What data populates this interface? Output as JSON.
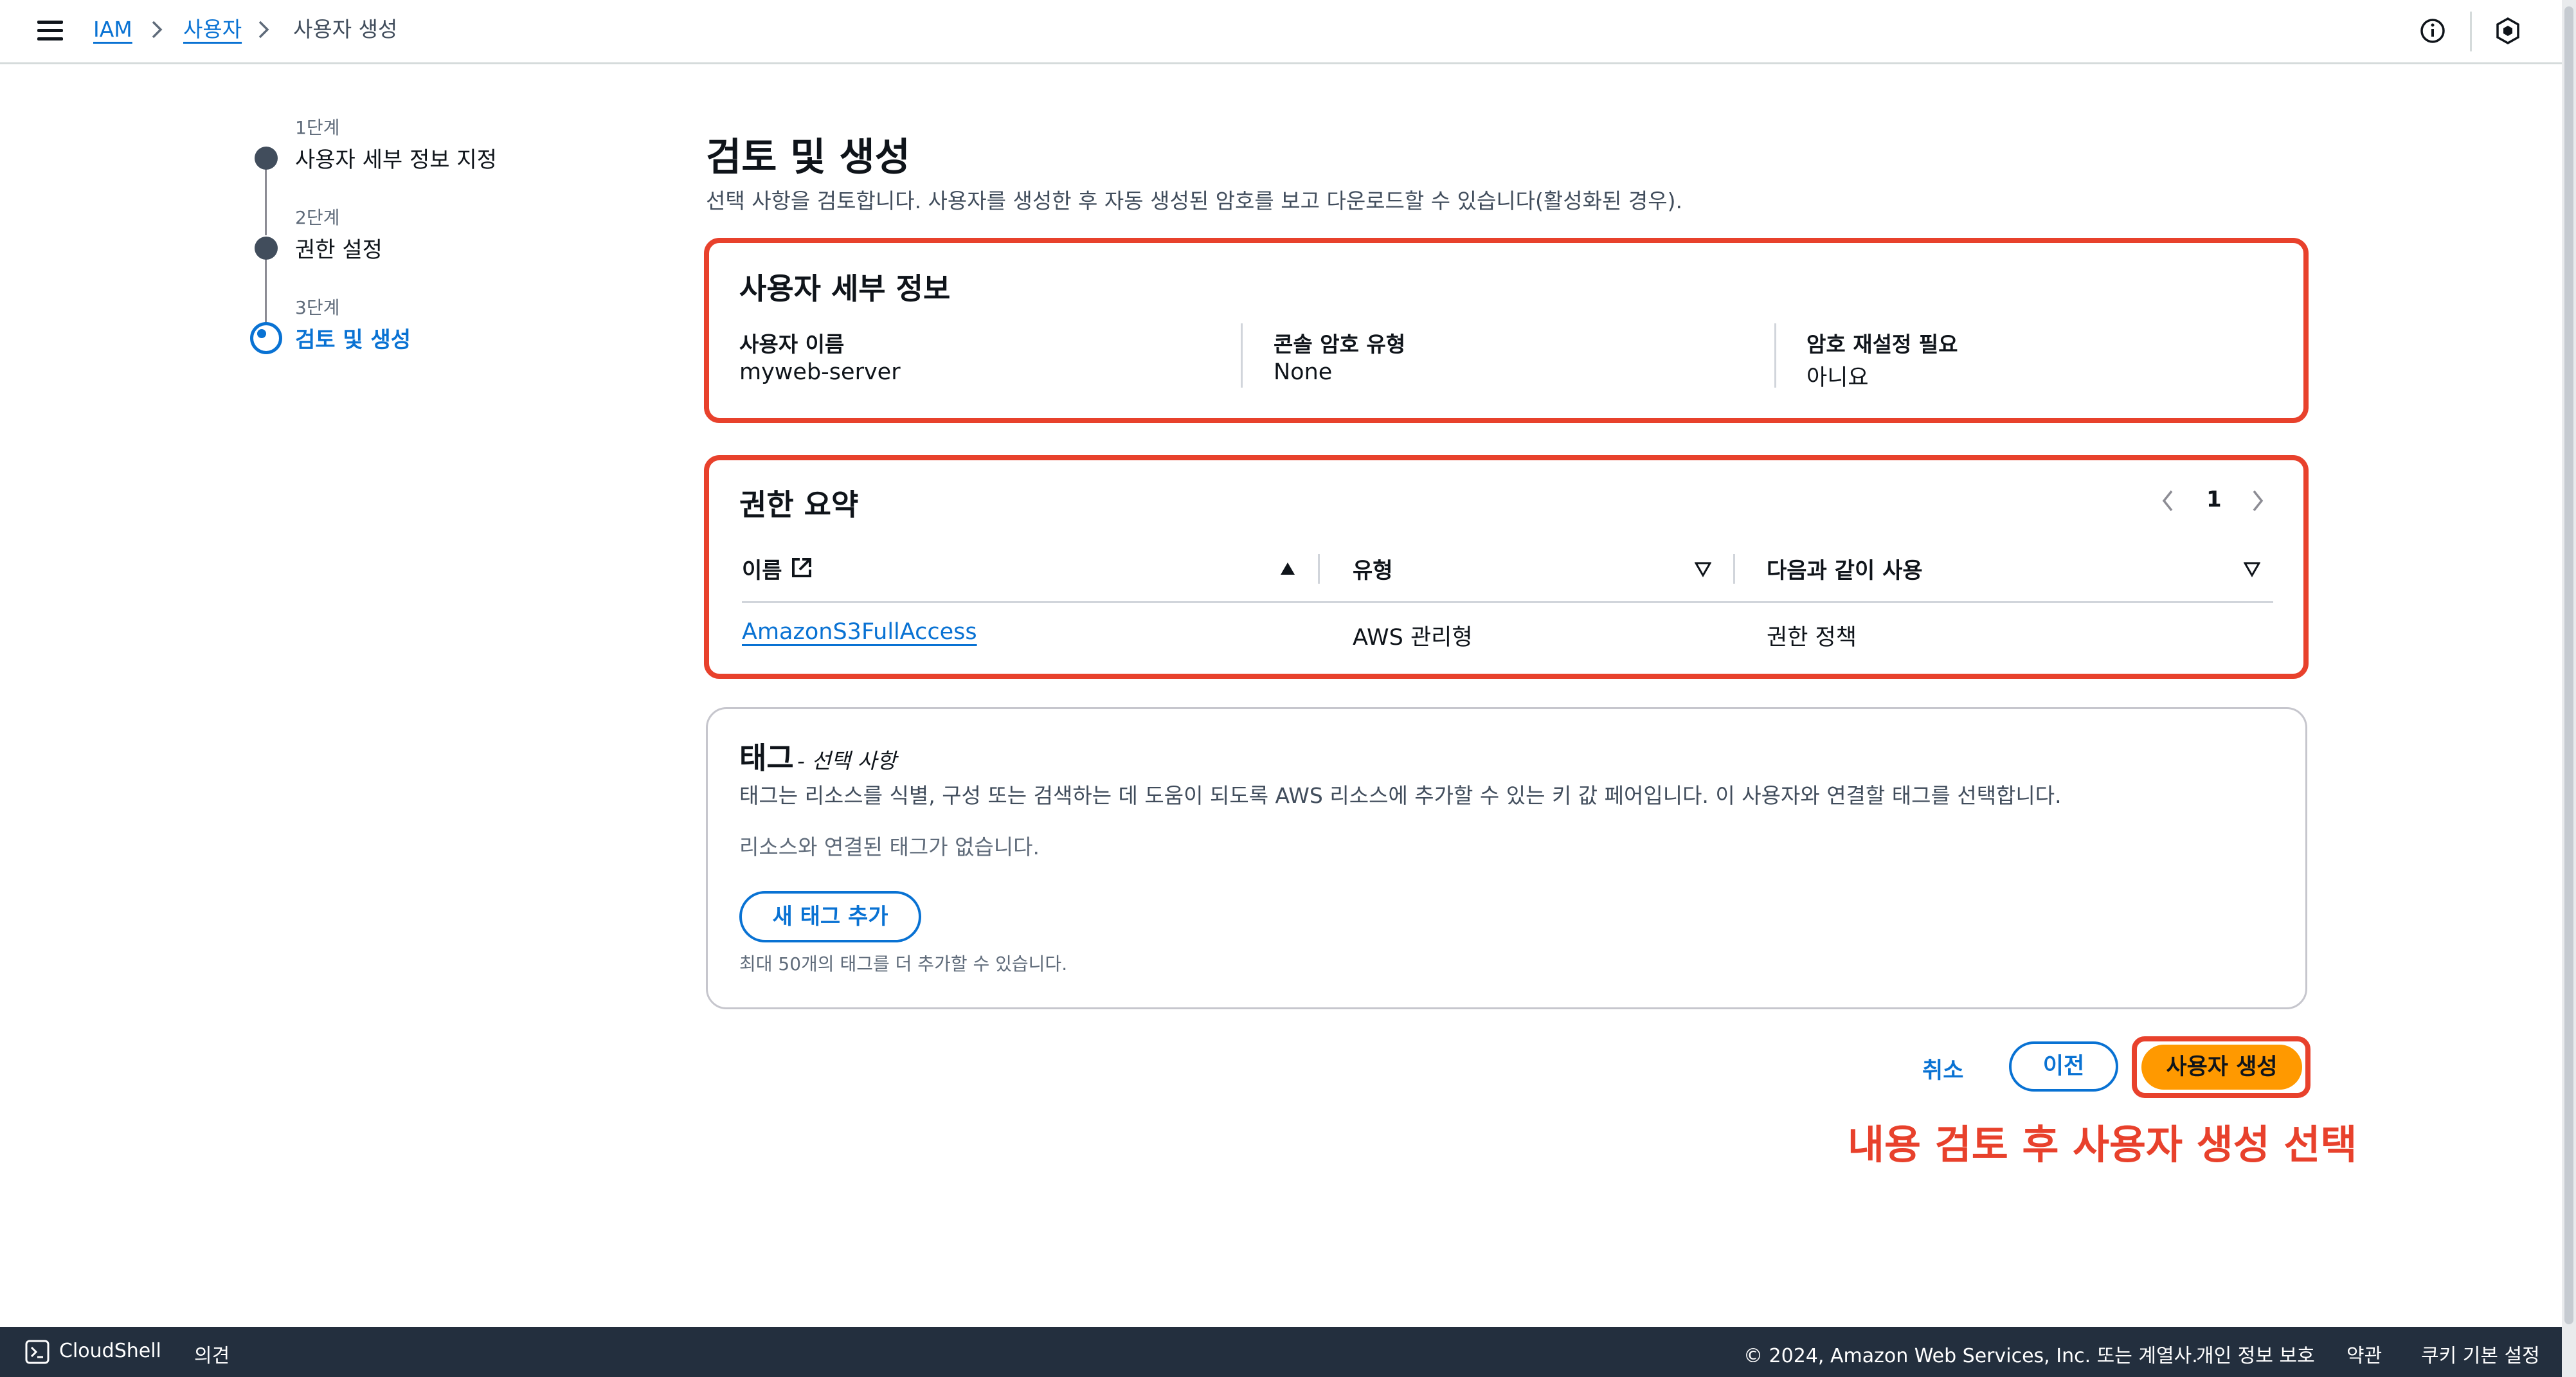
{
  "breadcrumb": {
    "items": [
      "IAM",
      "사용자"
    ],
    "current": "사용자 생성"
  },
  "steps": [
    {
      "number": "1단계",
      "title": "사용자 세부 정보 지정",
      "state": "completed"
    },
    {
      "number": "2단계",
      "title": "권한 설정",
      "state": "completed"
    },
    {
      "number": "3단계",
      "title": "검토 및 생성",
      "state": "active"
    }
  ],
  "page": {
    "title": "검토 및 생성",
    "description": "선택 사항을 검토합니다. 사용자를 생성한 후 자동 생성된 암호를 보고 다운로드할 수 있습니다(활성화된 경우)."
  },
  "user_details": {
    "title": "사용자 세부 정보",
    "fields": [
      {
        "label": "사용자 이름",
        "value": "myweb-server"
      },
      {
        "label": "콘솔 암호 유형",
        "value": "None"
      },
      {
        "label": "암호 재설정 필요",
        "value": "아니요"
      }
    ]
  },
  "permissions": {
    "title": "권한 요약",
    "page": "1",
    "columns": [
      "이름",
      "유형",
      "다음과 같이 사용"
    ],
    "rows": [
      {
        "name": "AmazonS3FullAccess",
        "type": "AWS 관리형",
        "used_as": "권한 정책"
      }
    ]
  },
  "tags": {
    "title": "태그",
    "optional": "- 선택 사항",
    "description": "태그는 리소스를 식별, 구성 또는 검색하는 데 도움이 되도록 AWS 리소스에 추가할 수 있는 키 값 페어입니다. 이 사용자와 연결할 태그를 선택합니다.",
    "empty": "리소스와 연결된 태그가 없습니다.",
    "add_button": "새 태그 추가",
    "hint": "최대 50개의 태그를 더 추가할 수 있습니다."
  },
  "actions": {
    "cancel": "취소",
    "previous": "이전",
    "create": "사용자 생성"
  },
  "annotation": "내용 검토 후 사용자 생성 선택",
  "footer": {
    "cloudshell": "CloudShell",
    "feedback": "의견",
    "copyright": "© 2024, Amazon Web Services, Inc. 또는 계열사.",
    "privacy": "개인 정보 보호",
    "terms": "약관",
    "cookies": "쿠키 기본 설정"
  },
  "colors": {
    "link": "#0972d3",
    "highlight": "#e8412c",
    "primary": "#ff9900",
    "footer": "#232f3e"
  }
}
